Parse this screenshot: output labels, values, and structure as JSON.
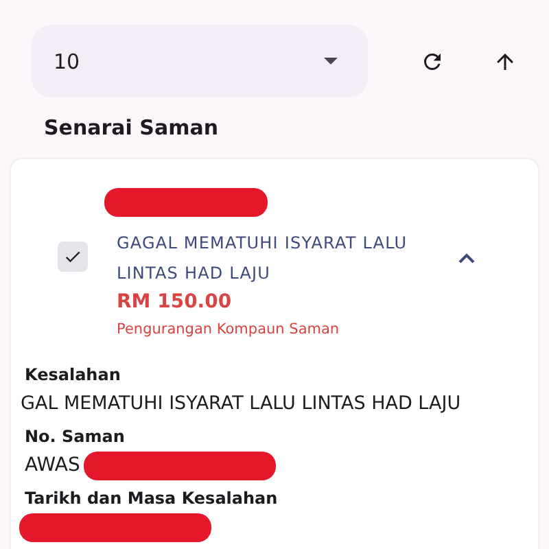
{
  "page_size_select": {
    "value": "10"
  },
  "section_title": "Senarai Saman",
  "summons": {
    "checked": true,
    "expanded": true,
    "offence": "GAGAL MEMATUHI ISYARAT LALU LINTAS HAD LAJU",
    "amount": "RM 150.00",
    "discount_note": "Pengurangan Kompaun Saman",
    "details": [
      {
        "label": "Kesalahan",
        "value": "GAL MEMATUHI ISYARAT LALU LINTAS HAD LAJU"
      },
      {
        "label": "No. Saman",
        "value": "AWAS",
        "redacted": true
      },
      {
        "label": "Tarikh dan Masa Kesalahan",
        "redacted": true
      }
    ]
  }
}
